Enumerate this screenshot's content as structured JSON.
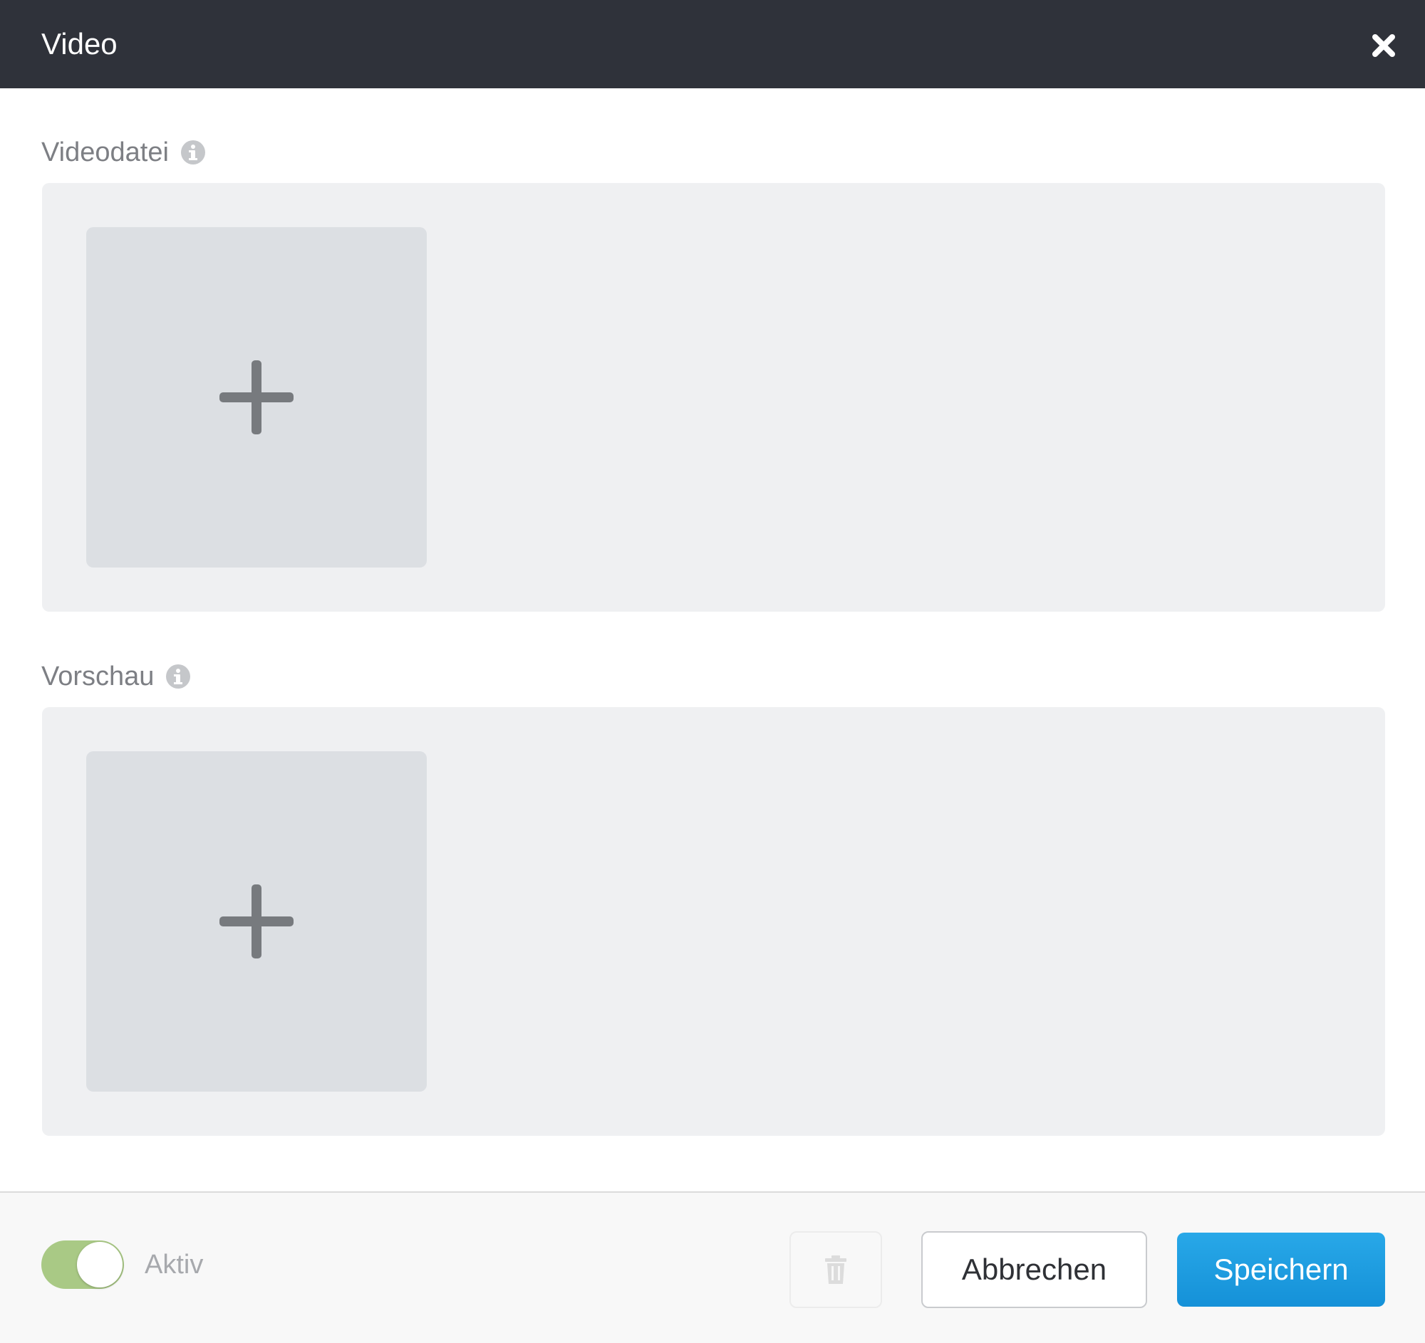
{
  "dialog": {
    "title": "Video",
    "close_icon": "close-icon"
  },
  "fields": {
    "video_file": {
      "label": "Videodatei",
      "info_icon": "info-icon",
      "add_icon": "plus-icon"
    },
    "preview": {
      "label": "Vorschau",
      "info_icon": "info-icon",
      "add_icon": "plus-icon"
    }
  },
  "footer": {
    "active_toggle": {
      "label": "Aktiv",
      "state": "on"
    },
    "delete_icon": "trash-icon",
    "cancel_label": "Abbrechen",
    "save_label": "Speichern"
  },
  "colors": {
    "header_bg": "#2f323a",
    "toggle_on": "#a9c985",
    "primary": "#1d9de0",
    "panel_bg": "#eff0f2",
    "tile_bg": "#dcdfe3"
  }
}
